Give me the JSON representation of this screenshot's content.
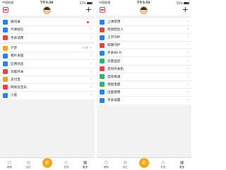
{
  "left": {
    "status": {
      "carrier": "中国联通",
      "wifi": "WiFi",
      "time": "下午5:50",
      "battery": "57%"
    },
    "groups": [
      [
        {
          "label": "通讯录",
          "color": "#2f80ed",
          "icon": "contacts-icon",
          "dot": true
        },
        {
          "label": "代收短信",
          "color": "#2f80ed",
          "icon": "sms-icon"
        },
        {
          "label": "手表话费",
          "color": "#e94343",
          "icon": "phone-bill-icon"
        }
      ],
      [
        {
          "label": "计步",
          "color": "#f2a129",
          "icon": "steps-icon",
          "extra": "52步"
        },
        {
          "label": "相片表盘",
          "color": "#2f80ed",
          "icon": "photo-dial-icon"
        },
        {
          "label": "应用商店",
          "color": "#2f80ed",
          "icon": "app-store-icon"
        },
        {
          "label": "功能开关",
          "color": "#e94343",
          "icon": "feature-switch-icon"
        },
        {
          "label": "支付宝",
          "color": "#f2a129",
          "icon": "alipay-icon"
        },
        {
          "label": "网易云音乐",
          "color": "#e94343",
          "icon": "music-icon"
        },
        {
          "label": "小度",
          "color": "#2f80ed",
          "icon": "xiaodu-icon"
        }
      ]
    ]
  },
  "right": {
    "status": {
      "carrier": "中国联通",
      "wifi": "WiFi",
      "time": "下午5:53",
      "battery": "56%"
    },
    "groups": [
      [
        {
          "label": "上课禁用",
          "color": "#2f80ed",
          "icon": "class-mode-icon"
        },
        {
          "label": "拒接陌生人",
          "color": "#e94343",
          "icon": "block-stranger-icon"
        },
        {
          "label": "上学守护",
          "color": "#2f80ed",
          "icon": "school-guard-icon"
        },
        {
          "label": "假期守护",
          "color": "#e94343",
          "icon": "holiday-guard-icon"
        },
        {
          "label": "手表Wi-Fi",
          "color": "#2f80ed",
          "icon": "wifi-icon"
        },
        {
          "label": "流量监控",
          "color": "#2bb673",
          "icon": "data-monitor-icon"
        },
        {
          "label": "定时开关机",
          "color": "#e94343",
          "icon": "timer-power-icon"
        },
        {
          "label": "自动接通",
          "color": "#2bb673",
          "icon": "auto-answer-icon"
        },
        {
          "label": "预留电量",
          "color": "#2bb673",
          "icon": "reserve-battery-icon"
        },
        {
          "label": "出国使用",
          "color": "#2f80ed",
          "icon": "abroad-icon"
        },
        {
          "label": "手表设置",
          "color": "#2f80ed",
          "icon": "watch-settings-icon"
        }
      ]
    ]
  },
  "tabbar": {
    "items": [
      {
        "label": "微聊",
        "icon": "chat-icon"
      },
      {
        "label": "定位",
        "icon": "location-icon"
      },
      {
        "label": "",
        "icon": "call-icon",
        "call": true
      },
      {
        "label": "发现",
        "icon": "discover-icon"
      },
      {
        "label": "更多",
        "icon": "more-icon",
        "active": true
      }
    ]
  }
}
